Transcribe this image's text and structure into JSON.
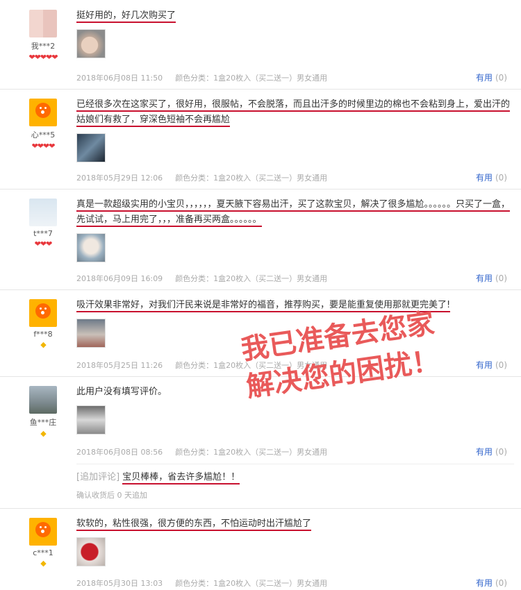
{
  "reviews": [
    {
      "user": "我***2",
      "rank_icon": "heart-icon",
      "rank": "❤❤❤❤❤",
      "text": "挺好用的，好几次购买了",
      "date": "2018年06月08日 11:50",
      "sku": "颜色分类：1盒20枚入（买二送一）男女通用",
      "useful_label": "有用",
      "useful_count": "(0)"
    },
    {
      "user": "心***5",
      "rank_icon": "heart-icon",
      "rank": "❤❤❤❤",
      "text": "已经很多次在这家买了，很好用，很服帖，不会脱落，而且出汗多的时候里边的棉也不会粘到身上，爱出汗的姑娘们有救了，穿深色短袖不会再尴尬",
      "date": "2018年05月29日 12:06",
      "sku": "颜色分类：1盒20枚入（买二送一）男女通用",
      "useful_label": "有用",
      "useful_count": "(0)"
    },
    {
      "user": "t***7",
      "rank_icon": "heart-icon",
      "rank": "❤❤❤",
      "text": "真是一款超级实用的小宝贝，，，，，，夏天腋下容易出汗，买了这款宝贝，解决了很多尴尬。。。。。。只买了一盒，先试试，马上用完了，，，准备再买两盒。。。。。。",
      "date": "2018年06月09日 16:09",
      "sku": "颜色分类：1盒20枚入（买二送一）男女通用",
      "useful_label": "有用",
      "useful_count": "(0)"
    },
    {
      "user": "f***8",
      "rank_icon": "diamond-icon",
      "rank": "◆",
      "text": "吸汗效果非常好，对我们汗民来说是非常好的福音，推荐购买，要是能重复使用那就更完美了!",
      "date": "2018年05月25日 11:26",
      "sku": "颜色分类：1盒20枚入（买二送一）男女通用",
      "useful_label": "有用",
      "useful_count": "(0)"
    },
    {
      "user": "鱼***庄",
      "rank_icon": "diamond-icon",
      "rank": "◆",
      "text": "此用户没有填写评价。",
      "date": "2018年06月08日 08:56",
      "sku": "颜色分类：1盒20枚入（买二送一）男女通用",
      "useful_label": "有用",
      "useful_count": "(0)",
      "append_label": "[追加评论]",
      "append_text": "宝贝棒棒，省去许多尴尬！！",
      "append_note": "确认收货后 0 天追加"
    },
    {
      "user": "c***1",
      "rank_icon": "diamond-icon",
      "rank": "◆",
      "text": "软软的，粘性很强，很方便的东西，不怕运动时出汗尴尬了",
      "date": "2018年05月30日 13:03",
      "sku": "颜色分类：1盒20枚入（买二送一）男女通用",
      "useful_label": "有用",
      "useful_count": "(0)"
    }
  ],
  "overlay": {
    "line1": "我已准备去您家",
    "line2": "解决您的困扰！"
  },
  "colors": {
    "underline": "#c8102e",
    "link": "#3366cc",
    "overlay": "#e95a5a"
  }
}
